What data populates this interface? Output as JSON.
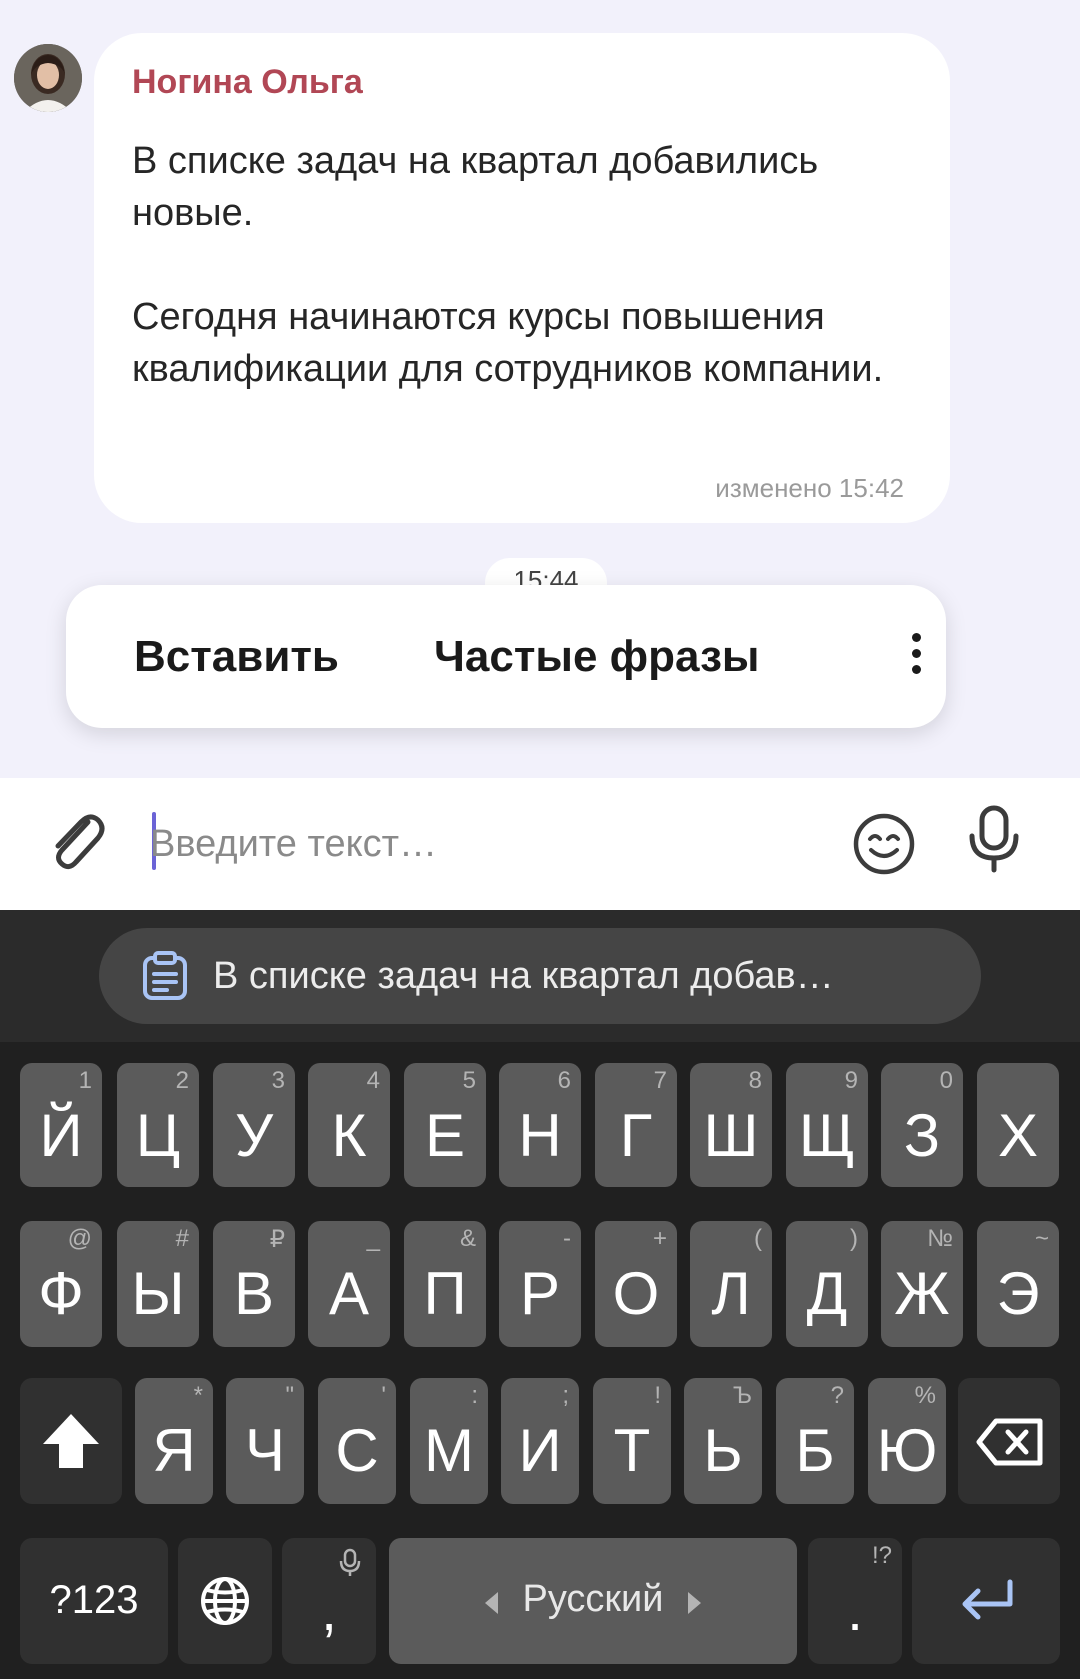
{
  "message": {
    "sender": "Ногина Ольга",
    "paragraph1": "В списке задач на квартал добавились новые.",
    "paragraph2": "Сегодня начинаются курсы повышения квалификации для сотрудников компании.",
    "edited": "изменено 15:42"
  },
  "time_divider": "15:44",
  "popup": {
    "paste": "Вставить",
    "phrases": "Частые фразы",
    "more_icon": "more-vertical-icon"
  },
  "input": {
    "placeholder": "Введите текст…",
    "attach_icon": "paperclip-icon",
    "emoji_icon": "smile-icon",
    "mic_icon": "microphone-icon"
  },
  "keyboard": {
    "clipboard_suggestion": "В списке задач на квартал добав…",
    "row1": [
      {
        "k": "Й",
        "h": "1"
      },
      {
        "k": "Ц",
        "h": "2"
      },
      {
        "k": "У",
        "h": "3"
      },
      {
        "k": "К",
        "h": "4"
      },
      {
        "k": "Е",
        "h": "5"
      },
      {
        "k": "Н",
        "h": "6"
      },
      {
        "k": "Г",
        "h": "7"
      },
      {
        "k": "Ш",
        "h": "8"
      },
      {
        "k": "Щ",
        "h": "9"
      },
      {
        "k": "З",
        "h": "0"
      },
      {
        "k": "Х",
        "h": ""
      }
    ],
    "row2": [
      {
        "k": "Ф",
        "h": "@"
      },
      {
        "k": "Ы",
        "h": "#"
      },
      {
        "k": "В",
        "h": "₽"
      },
      {
        "k": "А",
        "h": "_"
      },
      {
        "k": "П",
        "h": "&"
      },
      {
        "k": "Р",
        "h": "-"
      },
      {
        "k": "О",
        "h": "+"
      },
      {
        "k": "Л",
        "h": "("
      },
      {
        "k": "Д",
        "h": ")"
      },
      {
        "k": "Ж",
        "h": "№"
      },
      {
        "k": "Э",
        "h": "~"
      }
    ],
    "row3": [
      {
        "k": "Я",
        "h": "*"
      },
      {
        "k": "Ч",
        "h": "\""
      },
      {
        "k": "С",
        "h": "'"
      },
      {
        "k": "М",
        "h": ":"
      },
      {
        "k": "И",
        "h": ";"
      },
      {
        "k": "Т",
        "h": "!"
      },
      {
        "k": "Ь",
        "h": "Ъ"
      },
      {
        "k": "Б",
        "h": "?"
      },
      {
        "k": "Ю",
        "h": "%"
      }
    ],
    "symbols_key": "?123",
    "comma_key": ",",
    "space_label": "Русский",
    "period_key": ".",
    "period_hint": "!?",
    "shift_icon": "shift-arrow-icon",
    "backspace_icon": "backspace-icon",
    "globe_icon": "globe-icon",
    "enter_icon": "enter-icon",
    "comma_hint_icon": "microphone-icon"
  }
}
